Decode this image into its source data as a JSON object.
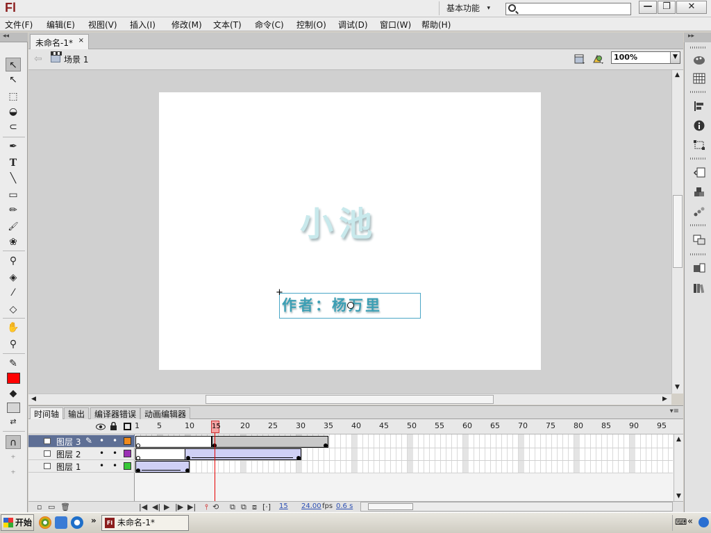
{
  "app": {
    "logo": "Fl",
    "workspace": "基本功能",
    "search": {
      "value": "",
      "placeholder": ""
    }
  },
  "window_controls": {
    "minimize": "—",
    "restore": "❐",
    "close": "✕"
  },
  "menu": [
    {
      "label": "文件(F)"
    },
    {
      "label": "编辑(E)"
    },
    {
      "label": "视图(V)"
    },
    {
      "label": "插入(I)"
    },
    {
      "label": "修改(M)"
    },
    {
      "label": "文本(T)"
    },
    {
      "label": "命令(C)"
    },
    {
      "label": "控制(O)"
    },
    {
      "label": "调试(D)"
    },
    {
      "label": "窗口(W)"
    },
    {
      "label": "帮助(H)"
    }
  ],
  "document": {
    "tab_title": "未命名-1*",
    "tab_close": "×"
  },
  "editbar": {
    "back": "⇦",
    "scene": "场景 1",
    "zoom": "100%",
    "zoom_dd": "▼"
  },
  "stage": {
    "title_text": "小池",
    "author_text": "作者：杨万里",
    "cross": "+"
  },
  "tools": [
    {
      "name": "selection-tool-icon",
      "glyph": "↖"
    },
    {
      "name": "subselection-tool-icon",
      "glyph": "↖"
    },
    {
      "name": "free-transform-tool-icon",
      "glyph": "⬚"
    },
    {
      "name": "3d-rotation-tool-icon",
      "glyph": "◒"
    },
    {
      "name": "lasso-tool-icon",
      "glyph": "⊂"
    },
    {
      "name": "pen-tool-icon",
      "glyph": "✒"
    },
    {
      "name": "text-tool-icon",
      "glyph": "T"
    },
    {
      "name": "line-tool-icon",
      "glyph": "╲"
    },
    {
      "name": "rectangle-tool-icon",
      "glyph": "▭"
    },
    {
      "name": "pencil-tool-icon",
      "glyph": "✏"
    },
    {
      "name": "brush-tool-icon",
      "glyph": "🖌"
    },
    {
      "name": "deco-tool-icon",
      "glyph": "❀"
    },
    {
      "name": "bone-tool-icon",
      "glyph": "⚲"
    },
    {
      "name": "paint-bucket-tool-icon",
      "glyph": "◈"
    },
    {
      "name": "eyedropper-tool-icon",
      "glyph": "⁄"
    },
    {
      "name": "eraser-tool-icon",
      "glyph": "◇"
    },
    {
      "name": "hand-tool-icon",
      "glyph": "✋"
    },
    {
      "name": "zoom-tool-icon",
      "glyph": "⚲"
    },
    {
      "name": "stroke-color-icon",
      "glyph": "✎"
    },
    {
      "name": "fill-color-icon",
      "glyph": "◆"
    },
    {
      "name": "swap-colors-icon",
      "glyph": "⇄"
    },
    {
      "name": "snap-magnet-icon",
      "glyph": "∩"
    },
    {
      "name": "smooth-icon",
      "glyph": "⁺"
    },
    {
      "name": "straighten-icon",
      "glyph": "⁺"
    }
  ],
  "colors": {
    "stroke": "#000000",
    "fill": "#ff0000",
    "accent_selected_layer": "#5e6f95",
    "playhead": "#e60000"
  },
  "timeline": {
    "tabs": [
      {
        "label": "时间轴",
        "active": true
      },
      {
        "label": "输出",
        "active": false
      },
      {
        "label": "编译器错误",
        "active": false
      },
      {
        "label": "动画编辑器",
        "active": false
      }
    ],
    "frame_numbers": [
      "1",
      "5",
      "10",
      "15",
      "20",
      "25",
      "30",
      "35",
      "40",
      "45",
      "50",
      "55",
      "60",
      "65",
      "70",
      "75",
      "80",
      "85",
      "90",
      "95"
    ],
    "current_frame": "15",
    "fps": "24.00",
    "fps_unit": "fps",
    "elapsed": "0.6 s",
    "layers": [
      {
        "name": "图层 3",
        "color": "#f08a1c",
        "selected": true
      },
      {
        "name": "图层 2",
        "color": "#9b2fb5",
        "selected": false
      },
      {
        "name": "图层 1",
        "color": "#38c838",
        "selected": false
      }
    ],
    "visible_dot": "•",
    "lock_dot": "•",
    "pencil": "✎"
  },
  "taskbar": {
    "start": "开始",
    "task": "未命名-1*",
    "task_icon": "Fl",
    "tray_chevron": "«"
  }
}
